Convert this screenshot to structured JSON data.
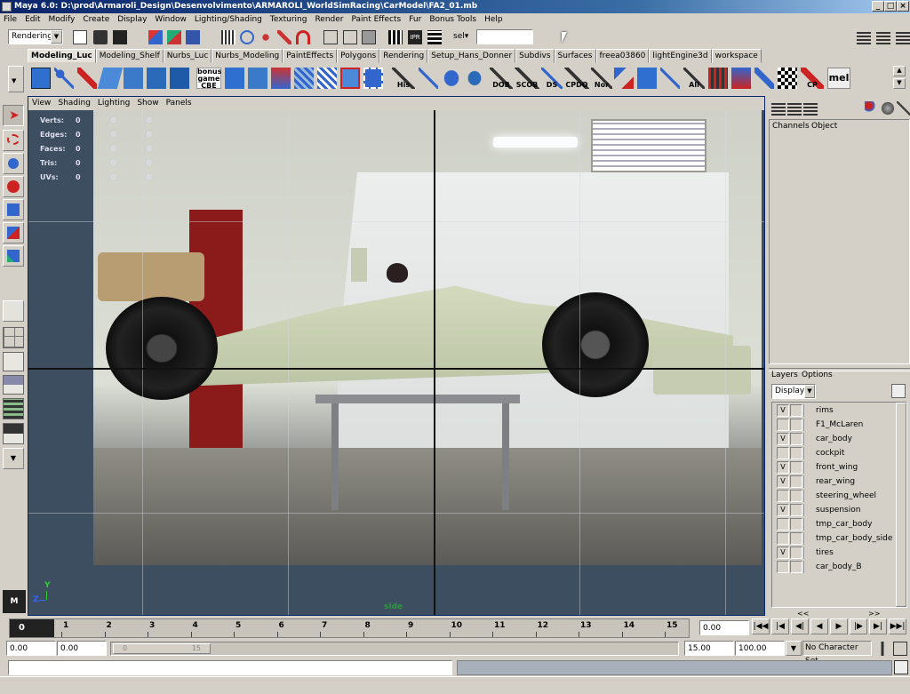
{
  "window": {
    "title": "Maya 6.0: D:\\prod\\Armaroli_Design\\Desenvolvimento\\ARMAROLI_WorldSimRacing\\CarModel\\FA2_01.mb"
  },
  "menu": [
    "File",
    "Edit",
    "Modify",
    "Create",
    "Display",
    "Window",
    "Lighting/Shading",
    "Texturing",
    "Render",
    "Paint Effects",
    "Fur",
    "Bonus Tools",
    "Help"
  ],
  "status_line": {
    "menu_set": "Rendering",
    "sel_label": "sel▾",
    "sel_value": ""
  },
  "shelf_tabs": [
    "Modeling_Luc",
    "Modeling_Shelf",
    "Nurbs_Luc",
    "Nurbs_Modeling",
    "PaintEffects",
    "Polygons",
    "Rendering",
    "Setup_Hans_Donner",
    "Subdivs",
    "Surfaces",
    "freea03860",
    "lightEngine3d",
    "workspace"
  ],
  "shelf_labels": {
    "bonus": "bonus",
    "game": "game",
    "cbe": "CBE",
    "his": "His",
    "dob": "DOB",
    "scob": "SCOB",
    "ds": "DS",
    "cpdo": "CPDO",
    "nor": "Nor",
    "all": "All",
    "cp": "CP",
    "mel": "mel"
  },
  "viewport": {
    "menu": [
      "View",
      "Shading",
      "Lighting",
      "Show",
      "Panels"
    ],
    "hud": [
      {
        "label": "Verts:",
        "a": "0",
        "b": "0",
        "c": "0"
      },
      {
        "label": "Edges:",
        "a": "0",
        "b": "0",
        "c": "0"
      },
      {
        "label": "Faces:",
        "a": "0",
        "b": "0",
        "c": "0"
      },
      {
        "label": "Tris:",
        "a": "0",
        "b": "0",
        "c": "0"
      },
      {
        "label": "UVs:",
        "a": "0",
        "b": "0",
        "c": "0"
      }
    ],
    "camera_name": "side",
    "axis_y": "Y",
    "axis_z": "Z"
  },
  "channel_box": {
    "tabs": [
      "Channels",
      "Object"
    ]
  },
  "layer_editor": {
    "tabs": [
      "Layers",
      "Options"
    ],
    "display_value": "Display",
    "layers": [
      {
        "name": "rims",
        "v": "V"
      },
      {
        "name": "F1_McLaren",
        "v": ""
      },
      {
        "name": "car_body",
        "v": "V"
      },
      {
        "name": "cockpit",
        "v": ""
      },
      {
        "name": "front_wing",
        "v": "V"
      },
      {
        "name": "rear_wing",
        "v": "V"
      },
      {
        "name": "steering_wheel",
        "v": ""
      },
      {
        "name": "suspension",
        "v": "V"
      },
      {
        "name": "tmp_car_body",
        "v": ""
      },
      {
        "name": "tmp_car_body_side",
        "v": ""
      },
      {
        "name": "tires",
        "v": "V"
      },
      {
        "name": "car_body_B",
        "v": ""
      }
    ],
    "scroll_left": "<<",
    "scroll_right": ">>"
  },
  "time_slider": {
    "ticks": [
      "1",
      "2",
      "3",
      "4",
      "5",
      "6",
      "7",
      "8",
      "9",
      "10",
      "11",
      "12",
      "13",
      "14",
      "15"
    ],
    "current_frame_marker": "0",
    "current_time": "0.00"
  },
  "range_slider": {
    "start_time": "0.00",
    "start_range": "0.00",
    "range_bar_start": "0",
    "range_bar_end": "15",
    "end_range": "15.00",
    "end_time": "100.00",
    "character_set": "No Character Set"
  },
  "colors": {
    "viewport_bg": "#3d4e60",
    "ui_grey": "#d4d0c8",
    "title_blue": "#0a246a",
    "hud_text": "#dde"
  }
}
